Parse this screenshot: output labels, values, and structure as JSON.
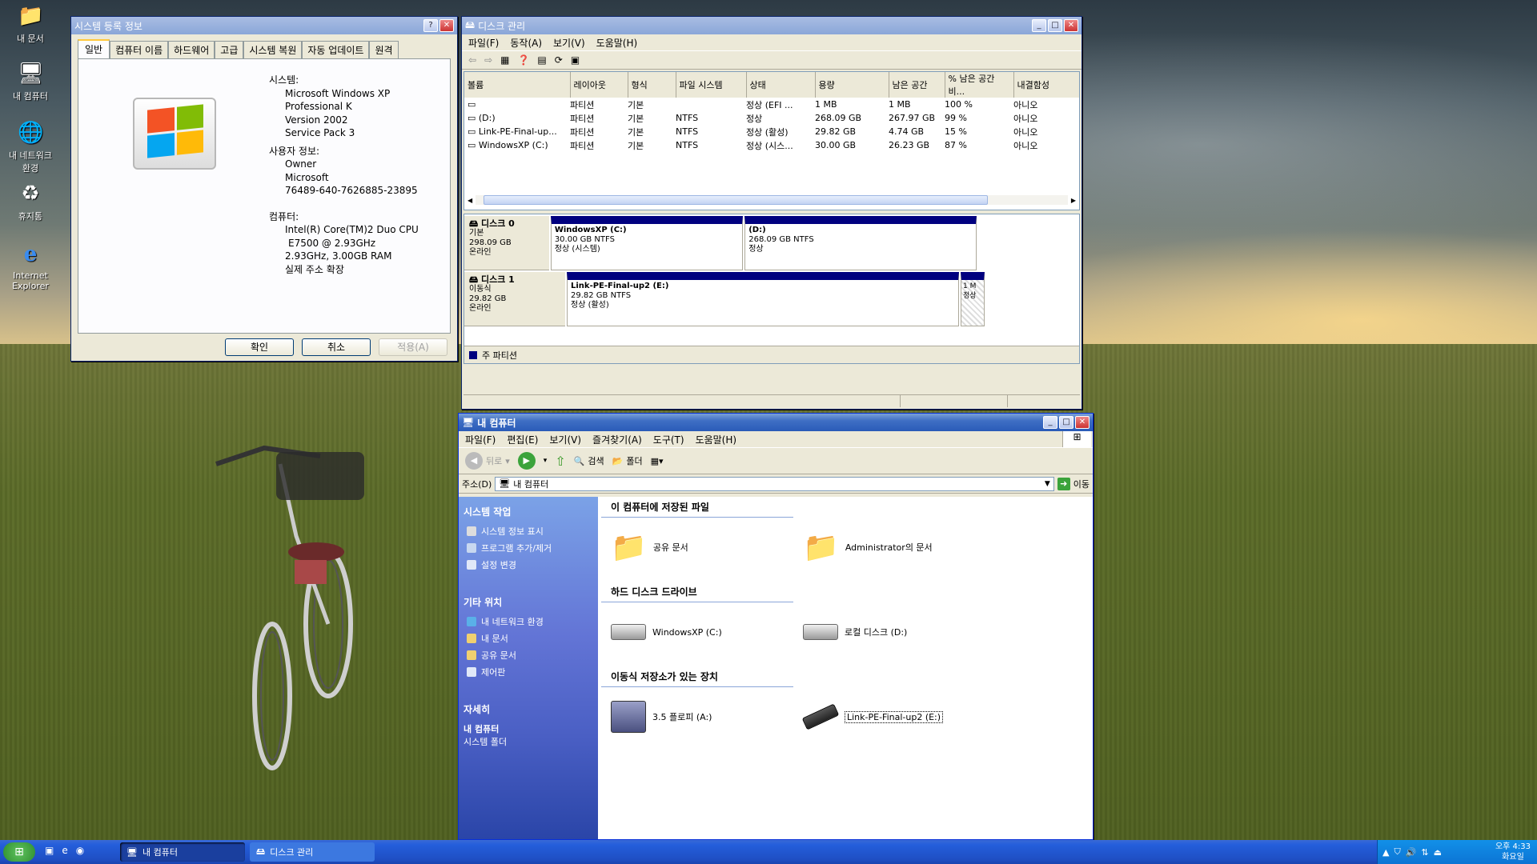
{
  "desktop_icons": [
    {
      "label": "내 문서",
      "icon": "folder-icon"
    },
    {
      "label": "내 컴퓨터",
      "icon": "computer-icon"
    },
    {
      "label": "내 네트워크 환경",
      "icon": "network-icon"
    },
    {
      "label": "휴지통",
      "icon": "recycle-bin-icon"
    },
    {
      "label": "Internet Explorer",
      "icon": "ie-icon"
    }
  ],
  "sysprops": {
    "title": "시스템 등록 정보",
    "tabs": [
      "일반",
      "컴퓨터 이름",
      "하드웨어",
      "고급",
      "시스템 복원",
      "자동 업데이트",
      "원격"
    ],
    "system_label": "시스템:",
    "system_lines": [
      "Microsoft Windows XP",
      "Professional K",
      "Version 2002",
      "Service Pack 3"
    ],
    "user_label": "사용자 정보:",
    "user_lines": [
      "Owner",
      "Microsoft",
      "76489-640-7626885-23895"
    ],
    "computer_label": "컴퓨터:",
    "computer_lines": [
      "Intel(R) Core(TM)2 Duo CPU",
      "E7500  @ 2.93GHz",
      "2.93GHz, 3.00GB RAM",
      "실제 주소 확장"
    ],
    "ok": "확인",
    "cancel": "취소",
    "apply": "적용(A)"
  },
  "diskmgmt": {
    "title": "디스크 관리",
    "menu": [
      "파일(F)",
      "동작(A)",
      "보기(V)",
      "도움말(H)"
    ],
    "columns": [
      "볼륨",
      "레이아웃",
      "형식",
      "파일 시스템",
      "상태",
      "용량",
      "남은 공간",
      "% 남은 공간 비...",
      "내결함성"
    ],
    "rows": [
      [
        "",
        "파티션",
        "기본",
        "",
        "정상 (EFI ...",
        "1 MB",
        "1 MB",
        "100 %",
        "아니오"
      ],
      [
        "(D:)",
        "파티션",
        "기본",
        "NTFS",
        "정상",
        "268.09 GB",
        "267.97 GB",
        "99 %",
        "아니오"
      ],
      [
        "Link-PE-Final-up...",
        "파티션",
        "기본",
        "NTFS",
        "정상 (활성)",
        "29.82 GB",
        "4.74 GB",
        "15 %",
        "아니오"
      ],
      [
        "WindowsXP (C:)",
        "파티션",
        "기본",
        "NTFS",
        "정상 (시스...",
        "30.00 GB",
        "26.23 GB",
        "87 %",
        "아니오"
      ]
    ],
    "disks": [
      {
        "name": "디스크 0",
        "type": "기본",
        "size": "298.09 GB",
        "status": "온라인",
        "parts": [
          {
            "name": "WindowsXP  (C:)",
            "size": "30.00 GB NTFS",
            "status": "정상 (시스템)"
          },
          {
            "name": "(D:)",
            "size": "268.09 GB NTFS",
            "status": "정상"
          }
        ]
      },
      {
        "name": "디스크 1",
        "type": "이동식",
        "size": "29.82 GB",
        "status": "온라인",
        "parts": [
          {
            "name": "Link-PE-Final-up2  (E:)",
            "size": "29.82 GB NTFS",
            "status": "정상 (활성)"
          },
          {
            "name": "1 M",
            "size": "",
            "status": "정상"
          }
        ]
      }
    ],
    "legend": "주 파티션",
    "colors": {
      "primary_partition": "#00007f"
    }
  },
  "mycomputer": {
    "title": "내 컴퓨터",
    "menu": [
      "파일(F)",
      "편집(E)",
      "보기(V)",
      "즐겨찾기(A)",
      "도구(T)",
      "도움말(H)"
    ],
    "toolbar": {
      "back": "뒤로",
      "search": "검색",
      "folders": "폴더"
    },
    "address_label": "주소(D)",
    "address_value": "내 컴퓨터",
    "go": "이동",
    "sidebar": {
      "system_tasks_title": "시스템 작업",
      "system_tasks": [
        "시스템 정보 표시",
        "프로그램 추가/제거",
        "설정 변경"
      ],
      "other_places_title": "기타 위치",
      "other_places": [
        "내 네트워크 환경",
        "내 문서",
        "공유 문서",
        "제어판"
      ],
      "details_title": "자세히",
      "details_name": "내 컴퓨터",
      "details_sub": "시스템 폴더"
    },
    "sections": [
      {
        "title": "이 컴퓨터에 저장된 파일",
        "items": [
          {
            "label": "공유 문서",
            "icon": "folder-icon"
          },
          {
            "label": "Administrator의 문서",
            "icon": "folder-icon"
          }
        ]
      },
      {
        "title": "하드 디스크 드라이브",
        "items": [
          {
            "label": "WindowsXP (C:)",
            "icon": "hard-drive-icon"
          },
          {
            "label": "로컬 디스크 (D:)",
            "icon": "hard-drive-icon"
          }
        ]
      },
      {
        "title": "이동식 저장소가 있는 장치",
        "items": [
          {
            "label": "3.5 플로피 (A:)",
            "icon": "floppy-icon"
          },
          {
            "label": "Link-PE-Final-up2 (E:)",
            "icon": "usb-drive-icon"
          }
        ]
      }
    ],
    "colors": {
      "sidebar": "#1e3f9c",
      "section_line": "#8aa6d8"
    }
  },
  "taskbar": {
    "tasks": [
      "내 컴퓨터",
      "디스크 관리"
    ],
    "clock_time": "오후 4:33",
    "clock_day": "화요일"
  }
}
